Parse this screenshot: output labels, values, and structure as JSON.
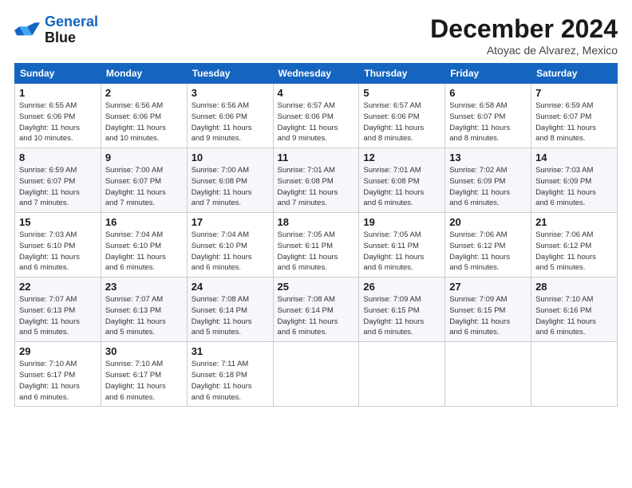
{
  "logo": {
    "line1": "General",
    "line2": "Blue"
  },
  "title": "December 2024",
  "location": "Atoyac de Alvarez, Mexico",
  "days_of_week": [
    "Sunday",
    "Monday",
    "Tuesday",
    "Wednesday",
    "Thursday",
    "Friday",
    "Saturday"
  ],
  "weeks": [
    [
      {
        "day": 1,
        "sunrise": "6:55 AM",
        "sunset": "6:06 PM",
        "daylight": "11 hours and 10 minutes."
      },
      {
        "day": 2,
        "sunrise": "6:56 AM",
        "sunset": "6:06 PM",
        "daylight": "11 hours and 10 minutes."
      },
      {
        "day": 3,
        "sunrise": "6:56 AM",
        "sunset": "6:06 PM",
        "daylight": "11 hours and 9 minutes."
      },
      {
        "day": 4,
        "sunrise": "6:57 AM",
        "sunset": "6:06 PM",
        "daylight": "11 hours and 9 minutes."
      },
      {
        "day": 5,
        "sunrise": "6:57 AM",
        "sunset": "6:06 PM",
        "daylight": "11 hours and 8 minutes."
      },
      {
        "day": 6,
        "sunrise": "6:58 AM",
        "sunset": "6:07 PM",
        "daylight": "11 hours and 8 minutes."
      },
      {
        "day": 7,
        "sunrise": "6:59 AM",
        "sunset": "6:07 PM",
        "daylight": "11 hours and 8 minutes."
      }
    ],
    [
      {
        "day": 8,
        "sunrise": "6:59 AM",
        "sunset": "6:07 PM",
        "daylight": "11 hours and 7 minutes."
      },
      {
        "day": 9,
        "sunrise": "7:00 AM",
        "sunset": "6:07 PM",
        "daylight": "11 hours and 7 minutes."
      },
      {
        "day": 10,
        "sunrise": "7:00 AM",
        "sunset": "6:08 PM",
        "daylight": "11 hours and 7 minutes."
      },
      {
        "day": 11,
        "sunrise": "7:01 AM",
        "sunset": "6:08 PM",
        "daylight": "11 hours and 7 minutes."
      },
      {
        "day": 12,
        "sunrise": "7:01 AM",
        "sunset": "6:08 PM",
        "daylight": "11 hours and 6 minutes."
      },
      {
        "day": 13,
        "sunrise": "7:02 AM",
        "sunset": "6:09 PM",
        "daylight": "11 hours and 6 minutes."
      },
      {
        "day": 14,
        "sunrise": "7:03 AM",
        "sunset": "6:09 PM",
        "daylight": "11 hours and 6 minutes."
      }
    ],
    [
      {
        "day": 15,
        "sunrise": "7:03 AM",
        "sunset": "6:10 PM",
        "daylight": "11 hours and 6 minutes."
      },
      {
        "day": 16,
        "sunrise": "7:04 AM",
        "sunset": "6:10 PM",
        "daylight": "11 hours and 6 minutes."
      },
      {
        "day": 17,
        "sunrise": "7:04 AM",
        "sunset": "6:10 PM",
        "daylight": "11 hours and 6 minutes."
      },
      {
        "day": 18,
        "sunrise": "7:05 AM",
        "sunset": "6:11 PM",
        "daylight": "11 hours and 6 minutes."
      },
      {
        "day": 19,
        "sunrise": "7:05 AM",
        "sunset": "6:11 PM",
        "daylight": "11 hours and 6 minutes."
      },
      {
        "day": 20,
        "sunrise": "7:06 AM",
        "sunset": "6:12 PM",
        "daylight": "11 hours and 5 minutes."
      },
      {
        "day": 21,
        "sunrise": "7:06 AM",
        "sunset": "6:12 PM",
        "daylight": "11 hours and 5 minutes."
      }
    ],
    [
      {
        "day": 22,
        "sunrise": "7:07 AM",
        "sunset": "6:13 PM",
        "daylight": "11 hours and 5 minutes."
      },
      {
        "day": 23,
        "sunrise": "7:07 AM",
        "sunset": "6:13 PM",
        "daylight": "11 hours and 5 minutes."
      },
      {
        "day": 24,
        "sunrise": "7:08 AM",
        "sunset": "6:14 PM",
        "daylight": "11 hours and 5 minutes."
      },
      {
        "day": 25,
        "sunrise": "7:08 AM",
        "sunset": "6:14 PM",
        "daylight": "11 hours and 6 minutes."
      },
      {
        "day": 26,
        "sunrise": "7:09 AM",
        "sunset": "6:15 PM",
        "daylight": "11 hours and 6 minutes."
      },
      {
        "day": 27,
        "sunrise": "7:09 AM",
        "sunset": "6:15 PM",
        "daylight": "11 hours and 6 minutes."
      },
      {
        "day": 28,
        "sunrise": "7:10 AM",
        "sunset": "6:16 PM",
        "daylight": "11 hours and 6 minutes."
      }
    ],
    [
      {
        "day": 29,
        "sunrise": "7:10 AM",
        "sunset": "6:17 PM",
        "daylight": "11 hours and 6 minutes."
      },
      {
        "day": 30,
        "sunrise": "7:10 AM",
        "sunset": "6:17 PM",
        "daylight": "11 hours and 6 minutes."
      },
      {
        "day": 31,
        "sunrise": "7:11 AM",
        "sunset": "6:18 PM",
        "daylight": "11 hours and 6 minutes."
      },
      null,
      null,
      null,
      null
    ]
  ]
}
